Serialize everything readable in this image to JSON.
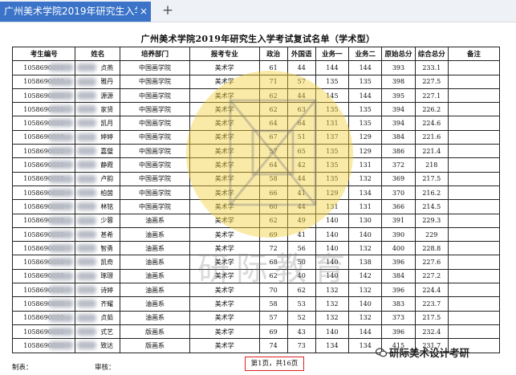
{
  "browser": {
    "tab_title": "广州美术学院2019年研究生入学",
    "close_glyph": "×",
    "new_tab_glyph": "+"
  },
  "document": {
    "title": "广州美术学院2019年研究生入学考试复试名单（学术型）",
    "columns": [
      "考生编号",
      "姓名",
      "培养部门",
      "报考专业",
      "政治",
      "外国语",
      "业务一",
      "业务二",
      "原始总分",
      "综合总分",
      "备注"
    ],
    "rows": [
      {
        "id": "1058690000",
        "name": "贞燕",
        "dept": "中国画学院",
        "major": "美术学",
        "politics": "61",
        "foreign": "44",
        "subj1": "144",
        "subj2": "144",
        "raw": "393",
        "total": "233.1",
        "note": ""
      },
      {
        "id": "1058690000",
        "name": "雅丹",
        "dept": "中国画学院",
        "major": "美术学",
        "politics": "71",
        "foreign": "57",
        "subj1": "135",
        "subj2": "135",
        "raw": "398",
        "total": "227.5",
        "note": ""
      },
      {
        "id": "1058690000",
        "name": "源源",
        "dept": "中国画学院",
        "major": "美术学",
        "politics": "62",
        "foreign": "44",
        "subj1": "145",
        "subj2": "144",
        "raw": "395",
        "total": "227.1",
        "note": ""
      },
      {
        "id": "1058690000",
        "name": "家贤",
        "dept": "中国画学院",
        "major": "美术学",
        "politics": "62",
        "foreign": "63",
        "subj1": "135",
        "subj2": "135",
        "raw": "394",
        "total": "226.2",
        "note": ""
      },
      {
        "id": "1058690000",
        "name": "凯月",
        "dept": "中国画学院",
        "major": "美术学",
        "politics": "64",
        "foreign": "64",
        "subj1": "131",
        "subj2": "135",
        "raw": "394",
        "total": "224.6",
        "note": ""
      },
      {
        "id": "1058690000",
        "name": "婷婷",
        "dept": "中国画学院",
        "major": "美术学",
        "politics": "67",
        "foreign": "51",
        "subj1": "137",
        "subj2": "129",
        "raw": "384",
        "total": "221.6",
        "note": ""
      },
      {
        "id": "1058690000",
        "name": "嘉璧",
        "dept": "中国画学院",
        "major": "美术学",
        "politics": "57",
        "foreign": "65",
        "subj1": "135",
        "subj2": "129",
        "raw": "386",
        "total": "221.4",
        "note": ""
      },
      {
        "id": "1058690000",
        "name": "静霞",
        "dept": "中国画学院",
        "major": "美术学",
        "politics": "64",
        "foreign": "42",
        "subj1": "135",
        "subj2": "131",
        "raw": "372",
        "total": "218",
        "note": ""
      },
      {
        "id": "1058690000",
        "name": "卢韵",
        "dept": "中国画学院",
        "major": "美术学",
        "politics": "58",
        "foreign": "44",
        "subj1": "135",
        "subj2": "132",
        "raw": "369",
        "total": "217.5",
        "note": ""
      },
      {
        "id": "1058690000",
        "name": "柏茵",
        "dept": "中国画学院",
        "major": "美术学",
        "politics": "66",
        "foreign": "41",
        "subj1": "129",
        "subj2": "134",
        "raw": "370",
        "total": "216.2",
        "note": ""
      },
      {
        "id": "1058690000",
        "name": "林铭",
        "dept": "中国画学院",
        "major": "美术学",
        "politics": "60",
        "foreign": "44",
        "subj1": "131",
        "subj2": "131",
        "raw": "366",
        "total": "214.5",
        "note": ""
      },
      {
        "id": "1058690000",
        "name": "少蓉",
        "dept": "油画系",
        "major": "美术学",
        "politics": "62",
        "foreign": "49",
        "subj1": "140",
        "subj2": "130",
        "raw": "391",
        "total": "229.3",
        "note": ""
      },
      {
        "id": "1058690000",
        "name": "甚希",
        "dept": "油画系",
        "major": "美术学",
        "politics": "69",
        "foreign": "41",
        "subj1": "140",
        "subj2": "140",
        "raw": "390",
        "total": "229",
        "note": ""
      },
      {
        "id": "1058690000",
        "name": "智勇",
        "dept": "油画系",
        "major": "美术学",
        "politics": "72",
        "foreign": "56",
        "subj1": "140",
        "subj2": "132",
        "raw": "400",
        "total": "228.8",
        "note": ""
      },
      {
        "id": "1058690000",
        "name": "凯奇",
        "dept": "油画系",
        "major": "美术学",
        "politics": "68",
        "foreign": "50",
        "subj1": "140",
        "subj2": "138",
        "raw": "396",
        "total": "227.6",
        "note": ""
      },
      {
        "id": "1058690000",
        "name": "琢璟",
        "dept": "油画系",
        "major": "美术学",
        "politics": "62",
        "foreign": "40",
        "subj1": "140",
        "subj2": "142",
        "raw": "384",
        "total": "227.2",
        "note": ""
      },
      {
        "id": "1058690000",
        "name": "诗婷",
        "dept": "油画系",
        "major": "美术学",
        "politics": "70",
        "foreign": "62",
        "subj1": "132",
        "subj2": "132",
        "raw": "396",
        "total": "224.4",
        "note": ""
      },
      {
        "id": "1058690000",
        "name": "齐耀",
        "dept": "油画系",
        "major": "美术学",
        "politics": "58",
        "foreign": "53",
        "subj1": "132",
        "subj2": "140",
        "raw": "383",
        "total": "223.7",
        "note": ""
      },
      {
        "id": "1058690000",
        "name": "贞茹",
        "dept": "油画系",
        "major": "美术学",
        "politics": "57",
        "foreign": "52",
        "subj1": "132",
        "subj2": "132",
        "raw": "373",
        "total": "217.5",
        "note": ""
      },
      {
        "id": "1058690000",
        "name": "式艺",
        "dept": "版画系",
        "major": "美术学",
        "politics": "69",
        "foreign": "43",
        "subj1": "140",
        "subj2": "144",
        "raw": "396",
        "total": "232.4",
        "note": ""
      },
      {
        "id": "1058690000",
        "name": "致达",
        "dept": "版画系",
        "major": "美术学",
        "politics": "74",
        "foreign": "73",
        "subj1": "134",
        "subj2": "134",
        "raw": "415",
        "total": "231.7",
        "note": ""
      }
    ]
  },
  "watermark": {
    "text": "研际教育",
    "color": "#f4d03f"
  },
  "footer": {
    "preparer_label": "制表：",
    "reviewer_label": "审核：",
    "page_info": "第1页，共16页",
    "wechat_account": "研际美术设计考研"
  }
}
